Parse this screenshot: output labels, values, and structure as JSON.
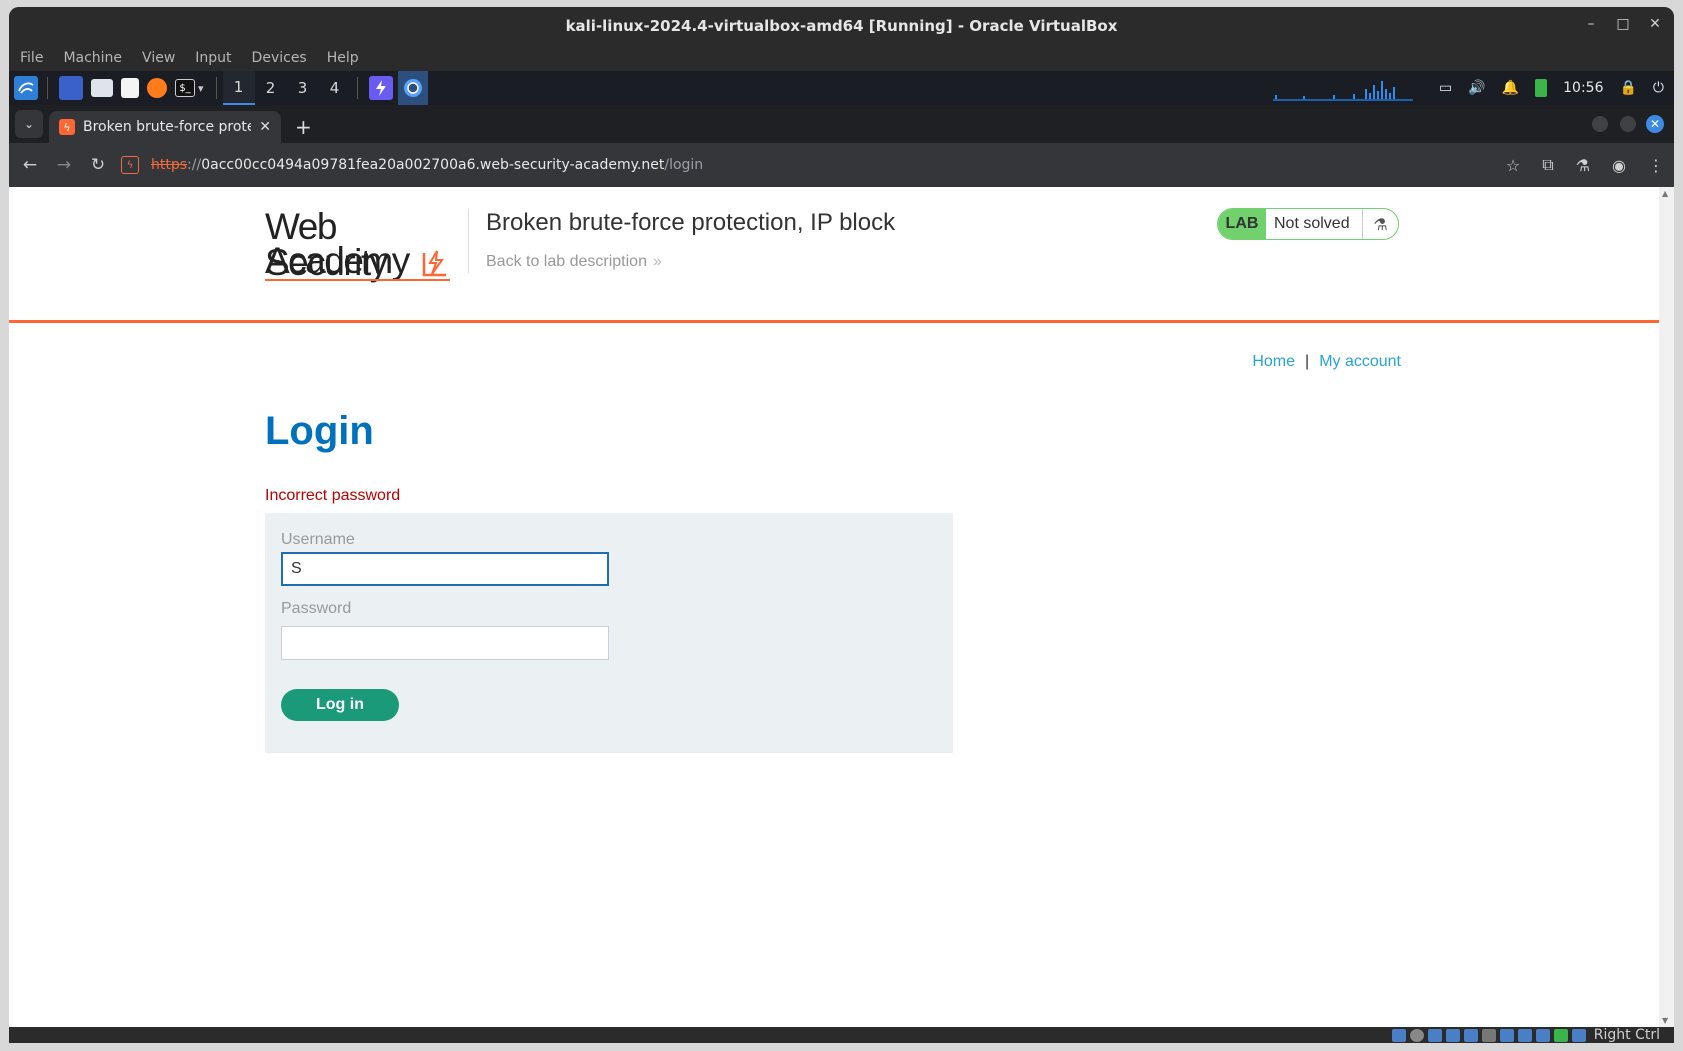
{
  "vbox": {
    "title": "kali-linux-2024.4-virtualbox-amd64 [Running] - Oracle VirtualBox",
    "menu": [
      "File",
      "Machine",
      "View",
      "Input",
      "Devices",
      "Help"
    ],
    "host_key": "Right Ctrl"
  },
  "kali_panel": {
    "workspaces": [
      "1",
      "2",
      "3",
      "4"
    ],
    "active_workspace": "1",
    "clock": "10:56"
  },
  "browser": {
    "tab_title": "Broken brute-force prote",
    "url_scheme": "https",
    "url_sep": "://",
    "url_host": "0acc00cc0494a09781fea20a002700a6.web-security-academy.net",
    "url_path": "/login"
  },
  "page": {
    "logo_line1": "Web Security",
    "logo_line2": "Academy",
    "lab_title": "Broken brute-force protection, IP block",
    "back_link": "Back to lab description",
    "badge_label": "LAB",
    "badge_status": "Not solved",
    "nav_home": "Home",
    "nav_separator": "|",
    "nav_account": "My account",
    "heading": "Login",
    "error": "Incorrect password",
    "username_label": "Username",
    "username_value": "S",
    "password_label": "Password",
    "password_value": "",
    "login_button": "Log in"
  },
  "colors": {
    "accent_orange": "#ff6633",
    "heading_blue": "#0071bc",
    "link_blue": "#29a3d6",
    "error_red": "#bd0000",
    "button_green": "#1b9a7a",
    "badge_green": "#70d16d"
  }
}
